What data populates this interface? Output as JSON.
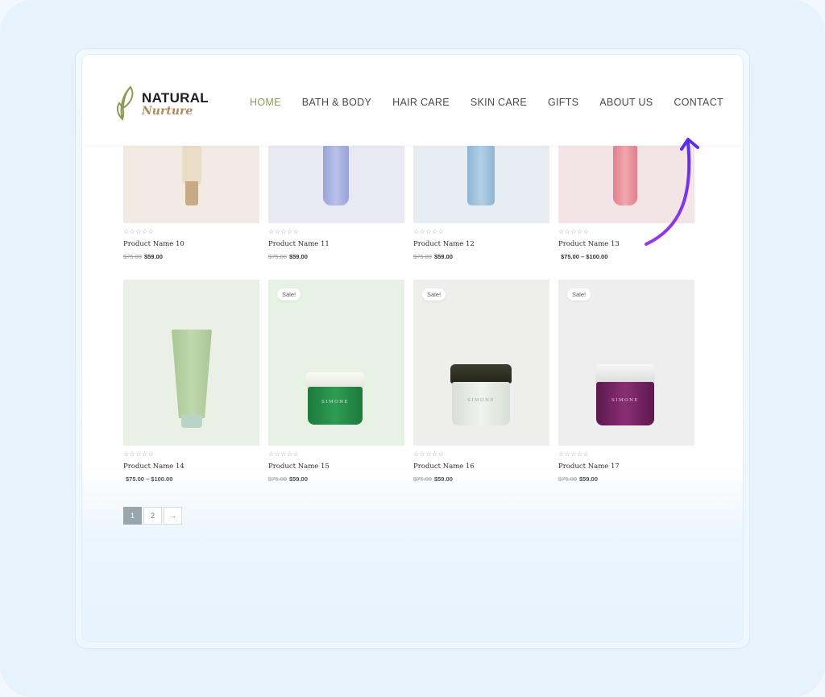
{
  "logo": {
    "title": "NATURAL",
    "subtitle": "Nurture"
  },
  "nav": {
    "items": [
      {
        "label": "HOME",
        "active": true
      },
      {
        "label": "BATH & BODY",
        "active": false
      },
      {
        "label": "HAIR CARE",
        "active": false
      },
      {
        "label": "SKIN CARE",
        "active": false
      },
      {
        "label": "GIFTS",
        "active": false
      },
      {
        "label": "ABOUT US",
        "active": false
      },
      {
        "label": "CONTACT",
        "active": false
      }
    ]
  },
  "products_top": [
    {
      "name": "Product Name 10",
      "old_price": "$75.00",
      "price": "$59.00",
      "bg": "#f2ebe3",
      "color": "#e8dcc8"
    },
    {
      "name": "Product Name 11",
      "old_price": "$75.00",
      "price": "$59.00",
      "bg": "#e9e9f3",
      "color": "#a9b2e2"
    },
    {
      "name": "Product Name 12",
      "old_price": "$75.00",
      "price": "$59.00",
      "bg": "#e6edf3",
      "color": "#9ec0dc"
    },
    {
      "name": "Product Name 13",
      "old_price": "",
      "price": "$75.00 – $100.00",
      "bg": "#f3e4e6",
      "color": "#e88b96"
    }
  ],
  "products_bottom": [
    {
      "name": "Product Name 14",
      "old_price": "",
      "price": "$75.00 – $100.00",
      "bg": "#eaf0e6",
      "sale": "",
      "jar_label": ""
    },
    {
      "name": "Product Name 15",
      "old_price": "$75.00",
      "price": "$59.00",
      "bg": "#e6f2e4",
      "sale": "Sale!",
      "jar_label": "SIMONE"
    },
    {
      "name": "Product Name 16",
      "old_price": "$75.00",
      "price": "$59.00",
      "bg": "#eeeeec",
      "sale": "Sale!",
      "jar_label": "SIMONE"
    },
    {
      "name": "Product Name 17",
      "old_price": "$75.00",
      "price": "$59.00",
      "bg": "#efeeee",
      "sale": "Sale!",
      "jar_label": "SIMONE"
    }
  ],
  "ratings": "☆☆☆☆☆",
  "pagination": {
    "pages": [
      "1",
      "2"
    ],
    "next": "→",
    "current": "1"
  },
  "accent_color": "#8a9b54",
  "arrow_color": "#7b2ff0"
}
